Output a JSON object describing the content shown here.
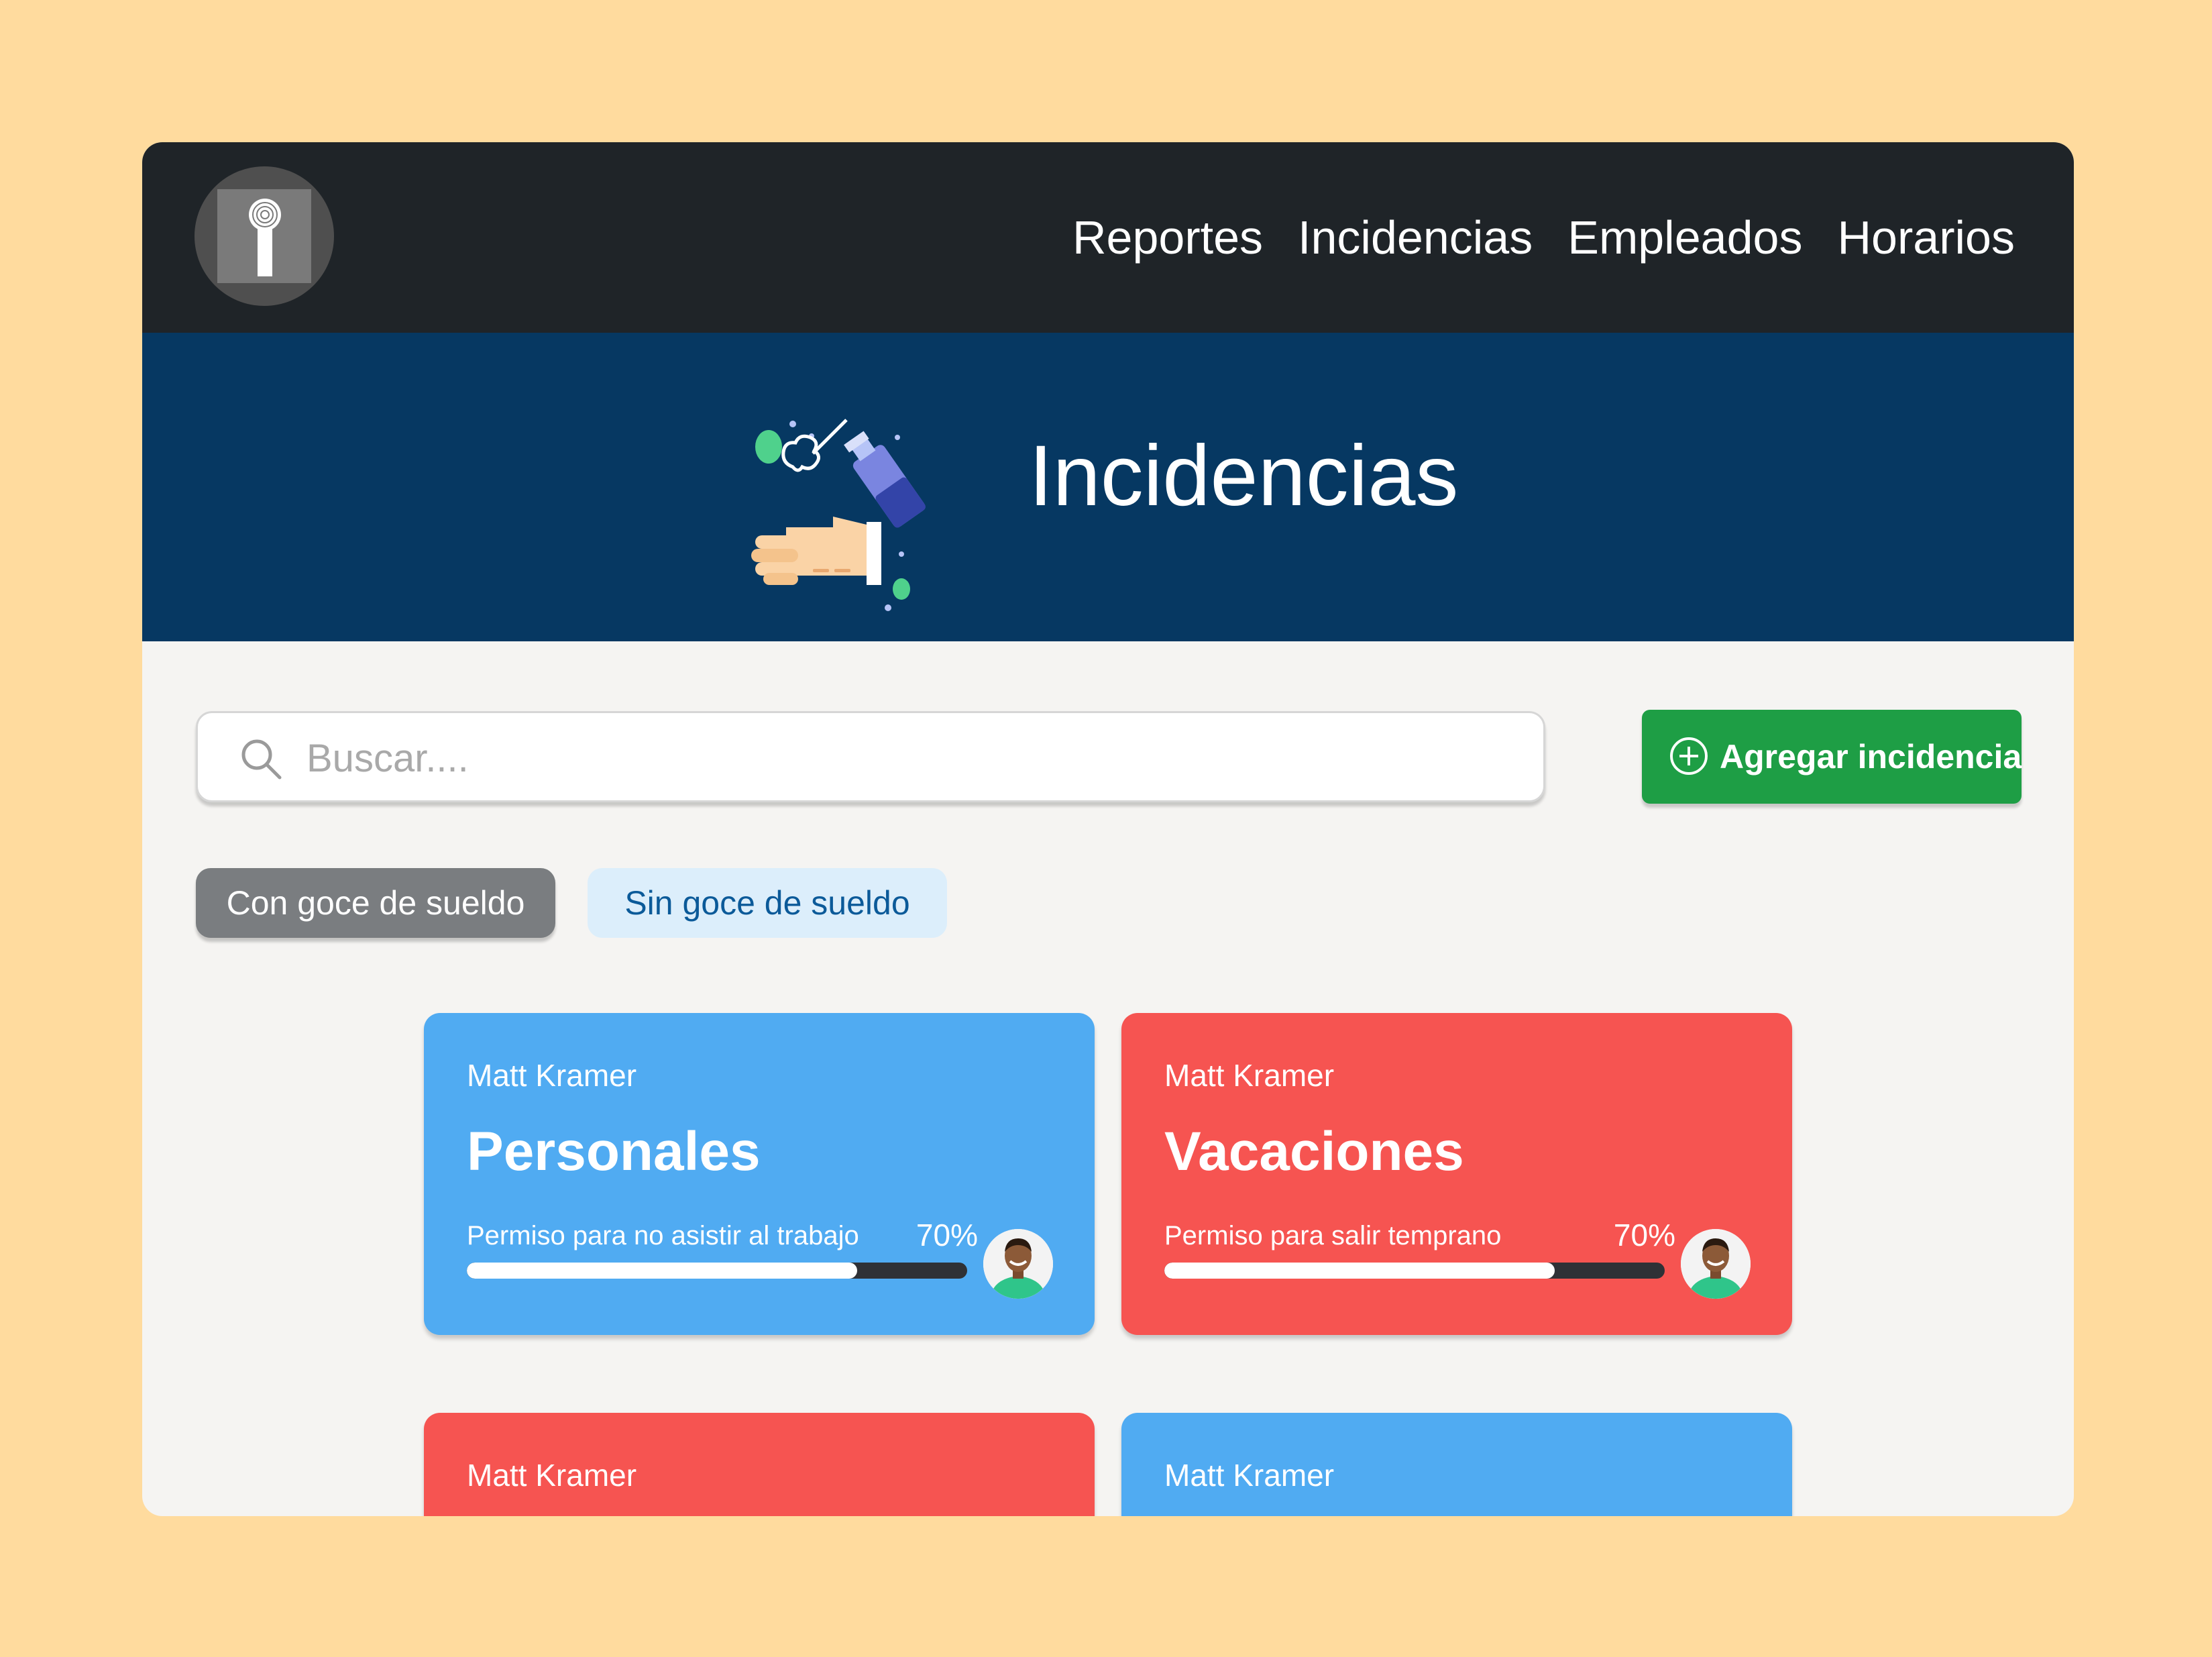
{
  "nav": {
    "items": [
      "Reportes",
      "Incidencias",
      "Empleados",
      "Horarios"
    ]
  },
  "hero": {
    "title": "Incidencias"
  },
  "search": {
    "placeholder": "Buscar....",
    "value": ""
  },
  "actions": {
    "add_label": "Agregar incidencia"
  },
  "filters": {
    "paid": "Con goce de sueldo",
    "unpaid": "Sin goce de sueldo"
  },
  "colors": {
    "navbar": "#1F2428",
    "hero": "#063862",
    "card_blue": "#50ABF2",
    "card_red": "#F65451",
    "add_button": "#1E9E45"
  },
  "cards": [
    {
      "employee": "Matt Kramer",
      "type": "Personales",
      "description": "Permiso para no asistir al trabajo",
      "percent_label": "70%",
      "progress": 0.78,
      "color": "blue"
    },
    {
      "employee": "Matt Kramer",
      "type": "Vacaciones",
      "description": "Permiso para salir temprano",
      "percent_label": "70%",
      "progress": 0.78,
      "color": "red"
    },
    {
      "employee": "Matt Kramer",
      "color": "red"
    },
    {
      "employee": "Matt Kramer",
      "color": "blue"
    }
  ]
}
